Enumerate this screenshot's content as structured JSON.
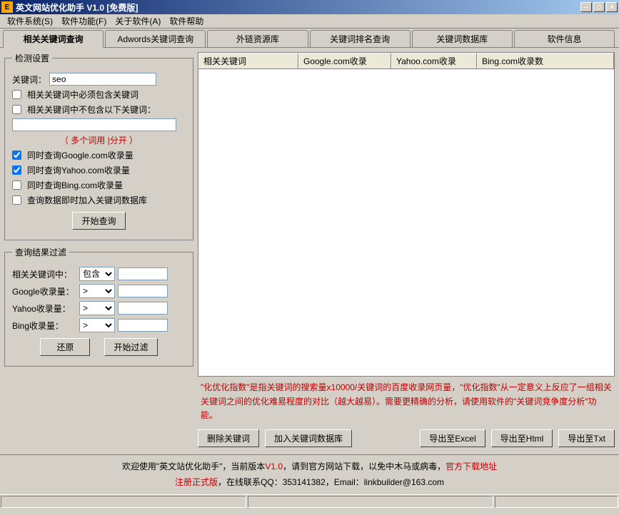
{
  "window": {
    "title": "英文网站优化助手  V1.0  [免费版]"
  },
  "menu": {
    "system": "软件系统(S)",
    "function": "软件功能(F)",
    "about": "关于软件(A)",
    "help": "软件帮助"
  },
  "tabs": [
    "相关关键词查询",
    "Adwords关键词查询",
    "外链资源库",
    "关键词排名查询",
    "关键词数据库",
    "软件信息"
  ],
  "detect": {
    "legend": "检测设置",
    "keyword_label": "关键词：",
    "keyword_value": "seo",
    "must_contain": "相关关键词中必须包含关键词",
    "must_exclude": "相关关键词中不包含以下关键词：",
    "exclude_value": "",
    "split_hint": "（ 多个词用 |分开 ）",
    "check_google": "同时查询Google.com收录量",
    "check_yahoo": "同时查询Yahoo.com收录量",
    "check_bing": "同时查询Bing.com收录量",
    "add_db": "查询数据即时加入关键词数据库",
    "start_btn": "开始查询"
  },
  "filter": {
    "legend": "查询结果过滤",
    "related_label": "相关关键词中：",
    "related_op": "包含",
    "related_value": "",
    "google_label": "Google收录量：",
    "google_op": ">",
    "google_value": "",
    "yahoo_label": "Yahoo收录量：",
    "yahoo_op": ">",
    "yahoo_value": "",
    "bing_label": "Bing收录量：",
    "bing_op": ">",
    "bing_value": "",
    "reset_btn": "还原",
    "start_btn": "开始过滤"
  },
  "table": {
    "col1": "相关关键词",
    "col2": "Google.com收录",
    "col3": "Yahoo.com收录",
    "col4": "Bing.com收录数"
  },
  "hint": "\"化优化指数\"是指关键词的搜索量x10000/关键词的百度收录网页量，\"优化指数\"从一定意义上反应了一组相关关键词之间的优化难易程度的对比（越大越易）。需要更精确的分析，请使用软件的\"关键词竞争度分析\"功能。",
  "buttons": {
    "delete": "删除关键词",
    "add_db": "加入关键词数据库",
    "export_excel": "导出至Excel",
    "export_html": "导出至Html",
    "export_txt": "导出至Txt"
  },
  "footer": {
    "line1a": "欢迎使用\"英文站优化助手\"，当前版本",
    "version": "V1.0",
    "line1b": "，请到官方网站下载，以免中木马或病毒，",
    "link1": "官方下载地址",
    "line2a": "注册正式版",
    "line2b": "，在线联系QQ：353141382，Email：linkbuilder@163.com"
  }
}
